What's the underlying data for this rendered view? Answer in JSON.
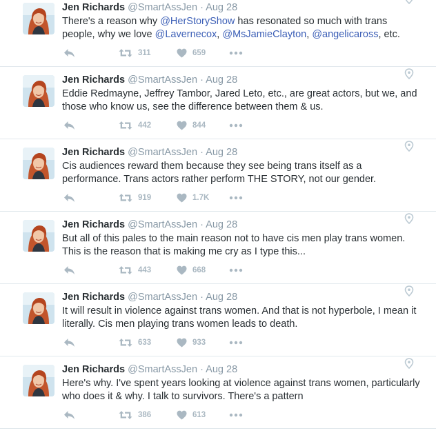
{
  "author": {
    "name": "Jen Richards",
    "handle": "@SmartAssJen",
    "separator": "·",
    "date": "Aug 28"
  },
  "tweets": [
    {
      "segments": [
        {
          "text": "There's a reason why ",
          "mention": false
        },
        {
          "text": "@HerStoryShow",
          "mention": true
        },
        {
          "text": " has resonated so much with trans people, why we love ",
          "mention": false
        },
        {
          "text": "@Lavernecox",
          "mention": true
        },
        {
          "text": ", ",
          "mention": false
        },
        {
          "text": "@MsJamieClayton",
          "mention": true
        },
        {
          "text": ", ",
          "mention": false
        },
        {
          "text": "@angelicaross",
          "mention": true
        },
        {
          "text": ", etc.",
          "mention": false
        }
      ],
      "retweets": "311",
      "likes": "659"
    },
    {
      "segments": [
        {
          "text": "Eddie Redmayne, Jeffrey Tambor, Jared Leto, etc., are great actors, but we, and those who know us, see the difference between them & us.",
          "mention": false
        }
      ],
      "retweets": "442",
      "likes": "844"
    },
    {
      "segments": [
        {
          "text": "Cis audiences reward them because they see being trans itself as a performance. Trans actors rather perform THE STORY, not our gender.",
          "mention": false
        }
      ],
      "retweets": "919",
      "likes": "1.7K"
    },
    {
      "segments": [
        {
          "text": "But all of this pales to the main reason not to have cis men play trans women. This is the reason that is making me cry as I type this...",
          "mention": false
        }
      ],
      "retweets": "443",
      "likes": "668"
    },
    {
      "segments": [
        {
          "text": "It will result in violence against trans women. And that is not hyperbole, I mean it literally. Cis men playing trans women leads to death.",
          "mention": false
        }
      ],
      "retweets": "633",
      "likes": "933"
    },
    {
      "segments": [
        {
          "text": "Here's why. I've spent years looking at violence against trans women, particularly who does it & why. I talk to survivors. There's a pattern",
          "mention": false
        }
      ],
      "retweets": "386",
      "likes": "613"
    }
  ],
  "icons": {
    "reply": "reply-icon",
    "retweet": "retweet-icon",
    "like": "heart-icon",
    "more": "more-dots-icon",
    "geo": "location-pin-icon",
    "avatar": "profile-photo"
  },
  "colors": {
    "text": "#292f33",
    "muted": "#8899a6",
    "mention": "#3b5eb6",
    "action": "#aab8c2",
    "divider": "#e1e8ed"
  }
}
